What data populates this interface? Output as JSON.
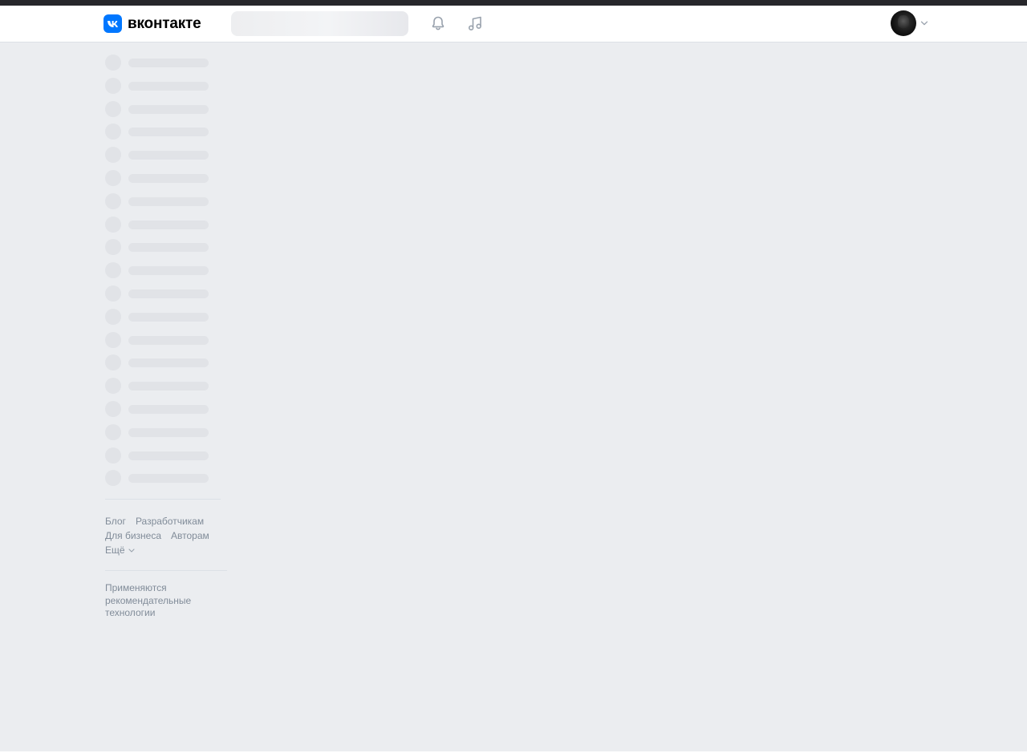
{
  "header": {
    "logo_text": "вконтакте",
    "bell_icon": "bell-icon",
    "music_icon": "music-note-icon",
    "profile_chevron_icon": "chevron-down-icon",
    "brand_color": "#0077ff"
  },
  "sidebar": {
    "skeleton_count": 19
  },
  "footer": {
    "links": [
      "Блог",
      "Разработчикам",
      "Для бизнеса",
      "Авторам"
    ],
    "more_label": "Ещё",
    "recommendation_note": "Применяются рекомендательные технологии"
  }
}
